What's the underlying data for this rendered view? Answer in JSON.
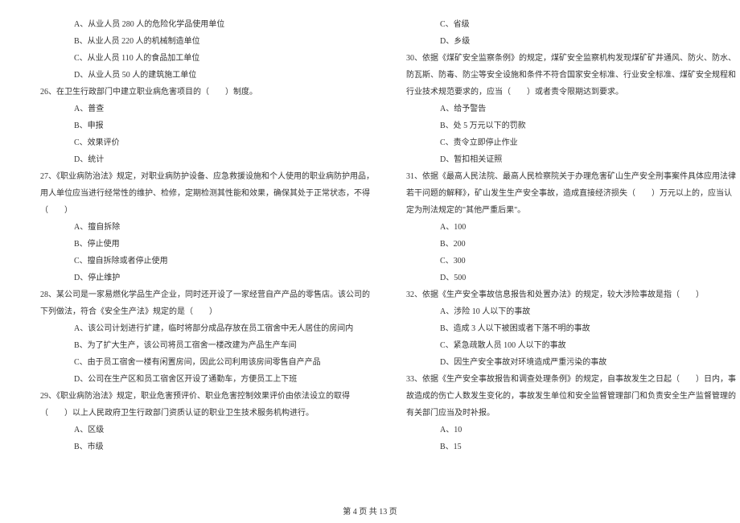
{
  "left": {
    "opt_a1": "A、从业人员 280 人的危险化学品使用单位",
    "opt_b1": "B、从业人员 220 人的机械制造单位",
    "opt_c1": "C、从业人员 110 人的食品加工单位",
    "opt_d1": "D、从业人员 50 人的建筑施工单位",
    "q26": "26、在卫生行政部门中建立职业病危害项目的（　　）制度。",
    "q26a": "A、普查",
    "q26b": "B、申报",
    "q26c": "C、效果评价",
    "q26d": "D、统计",
    "q27": "27、《职业病防治法》规定，对职业病防护设备、应急救援设施和个人使用的职业病防护用品，",
    "q27_2": "用人单位应当进行经常性的维护、检修，定期检测其性能和效果，确保其处于正常状态，不得",
    "q27_3": "（　　）",
    "q27a": "A、擅自拆除",
    "q27b": "B、停止使用",
    "q27c": "C、擅自拆除或者停止使用",
    "q27d": "D、停止维护",
    "q28": "28、某公司是一家易燃化学品生产企业，同时还开设了一家经营自产产品的零售店。该公司的",
    "q28_2": "下列做法，符合《安全生产法》规定的是（　　）",
    "q28a": "A、该公司计划进行扩建，临时将部分成品存放在员工宿舍中无人居住的房间内",
    "q28b": "B、为了扩大生产，该公司将员工宿舍一楼改建为产品生产车间",
    "q28c": "C、由于员工宿舍一楼有闲置房间，因此公司利用该房间零售自产产品",
    "q28d": "D、公司在生产区和员工宿舍区开设了通勤车，方便员工上下班",
    "q29": "29、《职业病防治法》规定，职业危害预评价、职业危害控制效果评价由依法设立的取得",
    "q29_2": "（　　）以上人民政府卫生行政部门资质认证的职业卫生技术服务机构进行。",
    "q29a": "A、区级",
    "q29b": "B、市级"
  },
  "right": {
    "q29c": "C、省级",
    "q29d": "D、乡级",
    "q30": "30、依据《煤矿安全监察条例》的规定，煤矿安全监察机构发现煤矿矿井通风、防火、防水、",
    "q30_2": "防瓦斯、防毒、防尘等安全设施和条件不符合国家安全标准、行业安全标准、煤矿安全规程和",
    "q30_3": "行业技术规范要求的，应当（　　）或者责令限期达到要求。",
    "q30a": "A、给予警告",
    "q30b": "B、处 5 万元以下的罚款",
    "q30c": "C、责令立即停止作业",
    "q30d": "D、暂扣相关证照",
    "q31": "31、依据《最高人民法院、最高人民检察院关于办理危害矿山生产安全刑事案件具体应用法律",
    "q31_2": "若干问题的解释》，矿山发生生产安全事故，造成直接经济损失（　　）万元以上的，应当认",
    "q31_3": "定为刑法规定的\"其他严重后果\"。",
    "q31a": "A、100",
    "q31b": "B、200",
    "q31c": "C、300",
    "q31d": "D、500",
    "q32": "32、依据《生产安全事故信息报告和处置办法》的规定，较大涉险事故是指（　　）",
    "q32a": "A、涉险 10 人以下的事故",
    "q32b": "B、造成 3 人以下被困或者下落不明的事故",
    "q32c": "C、紧急疏散人员 100 人以下的事故",
    "q32d": "D、因生产安全事故对环境造成严重污染的事故",
    "q33": "33、依据《生产安全事故报告和调查处理条例》的规定，自事故发生之日起（　　）日内，事",
    "q33_2": "故造成的伤亡人数发生变化的，事故发生单位和安全监督管理部门和负责安全生产监督管理的",
    "q33_3": "有关部门应当及时补报。",
    "q33a": "A、10",
    "q33b": "B、15"
  },
  "footer": "第 4 页 共 13 页"
}
